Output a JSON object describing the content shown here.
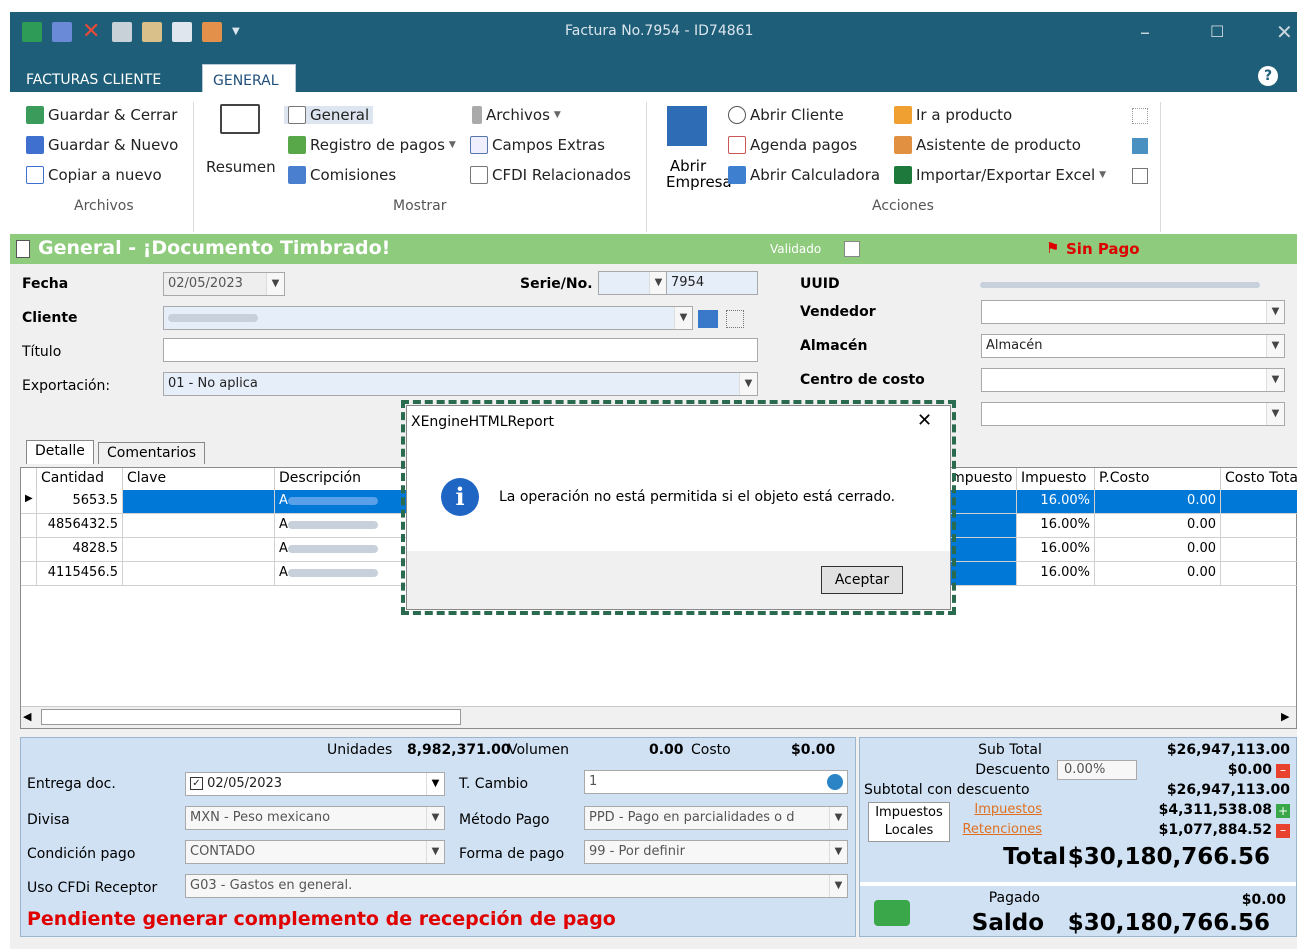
{
  "window": {
    "title": "Factura No.7954 - ID74861",
    "controls": {
      "minimize": "–",
      "maximize": "☐",
      "close": "✕"
    }
  },
  "ribbon": {
    "tabs": [
      "FACTURAS CLIENTE",
      "GENERAL"
    ],
    "help": "?",
    "archivos": {
      "save_close": "Guardar & Cerrar",
      "save_new": "Guardar & Nuevo",
      "copy_new": "Copiar a nuevo",
      "group": "Archivos"
    },
    "mostrar": {
      "resumen": "Resumen",
      "general": "General",
      "registro_pagos": "Registro de pagos",
      "comisiones": "Comisiones",
      "archivos": "Archivos",
      "campos_extras": "Campos Extras",
      "cfdi": "CFDI Relacionados",
      "group": "Mostrar"
    },
    "acciones": {
      "abrir_empresa_1": "Abrir",
      "abrir_empresa_2": "Empresa",
      "abrir_cliente": "Abrir Cliente",
      "agenda_pagos": "Agenda pagos",
      "abrir_calculadora": "Abrir Calculadora",
      "ir_producto": "Ir a producto",
      "asistente": "Asistente de producto",
      "importar": "Importar/Exportar Excel",
      "group": "Acciones"
    }
  },
  "status_bar": {
    "title": "General - ¡Documento Timbrado!",
    "validado": "Validado",
    "sin_pago": "Sin Pago"
  },
  "form": {
    "fecha_label": "Fecha",
    "fecha": "02/05/2023",
    "serie_label": "Serie/No.",
    "serie_no": "7954",
    "uuid_label": "UUID",
    "cliente_label": "Cliente",
    "vendedor_label": "Vendedor",
    "titulo_label": "Título",
    "almacen_label": "Almacén",
    "almacen": "Almacén",
    "exportacion_label": "Exportación:",
    "exportacion": "01 - No aplica",
    "centro_costo_label": "Centro de costo"
  },
  "detail_tabs": [
    "Detalle",
    "Comentarios"
  ],
  "grid": {
    "headers": [
      "Cantidad",
      "Clave",
      "Descripción",
      "Impuesto",
      "Impuesto",
      "P.Costo",
      "Costo Total"
    ],
    "rows": [
      {
        "cantidad": "5653.5",
        "desc": "A",
        "imp": "16.00%",
        "pcosto": "0.00"
      },
      {
        "cantidad": "4856432.5",
        "desc": "A",
        "imp": "16.00%",
        "pcosto": "0.00"
      },
      {
        "cantidad": "4828.5",
        "desc": "A",
        "imp": "16.00%",
        "pcosto": "0.00"
      },
      {
        "cantidad": "4115456.5",
        "desc": "A",
        "imp": "16.00%",
        "pcosto": "0.00"
      }
    ]
  },
  "footer": {
    "unidades_label": "Unidades",
    "unidades": "8,982,371.00",
    "volumen_label": "Volumen",
    "volumen": "0.00",
    "costo_label": "Costo",
    "costo": "$0.00",
    "entrega_label": "Entrega doc.",
    "entrega": "02/05/2023",
    "tcambio_label": "T. Cambio",
    "tcambio": "1",
    "divisa_label": "Divisa",
    "divisa": "MXN - Peso mexicano",
    "metodo_label": "Método Pago",
    "metodo": "PPD - Pago en parcialidades o d",
    "condicion_label": "Condición pago",
    "condicion": "CONTADO",
    "forma_label": "Forma de pago",
    "forma": "99 - Por definir",
    "uso_label": "Uso CFDi Receptor",
    "uso": "G03 - Gastos en general.",
    "warning": "Pendiente generar complemento de recepción de pago"
  },
  "totals": {
    "subtotal_label": "Sub Total",
    "subtotal": "$26,947,113.00",
    "descuento_label": "Descuento",
    "descuento_pct": "0.00%",
    "descuento": "$0.00",
    "subtotal_desc_label": "Subtotal con descuento",
    "subtotal_desc": "$26,947,113.00",
    "impuestos_locales_1": "Impuestos",
    "impuestos_locales_2": "Locales",
    "impuestos_label": "Impuestos",
    "impuestos": "$4,311,538.08",
    "retenciones_label": "Retenciones",
    "retenciones": "$1,077,884.52",
    "total_label": "Total",
    "total": "$30,180,766.56",
    "pagado_label": "Pagado",
    "pagado": "$0.00",
    "saldo_label": "Saldo",
    "saldo": "$30,180,766.56"
  },
  "dialog": {
    "title": "XEngineHTMLReport",
    "close": "✕",
    "message": "La operación no está permitida si el objeto está cerrado.",
    "button": "Aceptar"
  },
  "colors": {
    "title_bar": "#1f5e78",
    "status_green": "#8fcb7d",
    "selected_row": "#0078d7",
    "footer_bg": "#cfe1f3",
    "warning_red": "#e00000"
  }
}
